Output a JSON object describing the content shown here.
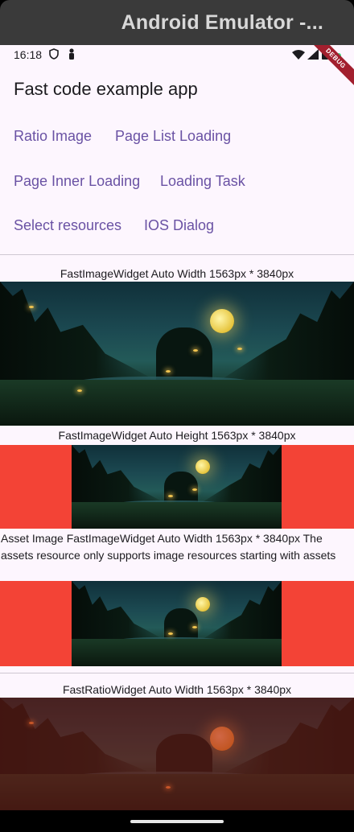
{
  "window": {
    "title": "Android Emulator -..."
  },
  "status_bar": {
    "time": "16:18",
    "debug_banner": "DEBUG"
  },
  "app": {
    "title": "Fast code example app"
  },
  "nav": [
    "Ratio Image",
    "Page List Loading",
    "Page Inner Loading",
    "Loading Task",
    "Select resources",
    "IOS Dialog"
  ],
  "sections": {
    "auto_width_caption": "FastImageWidget Auto Width 1563px * 3840px",
    "auto_height_caption": "FastImageWidget Auto Height 1563px * 3840px",
    "asset_caption": "Asset Image FastImageWidget Auto Width 1563px * 3840px The assets resource only supports image resources starting with assets",
    "ratio_caption": "FastRatioWidget Auto Width 1563px * 3840px"
  },
  "colors": {
    "accent": "#6a52a4",
    "red_background": "#f34336",
    "screen_background": "#fdf6fe"
  }
}
